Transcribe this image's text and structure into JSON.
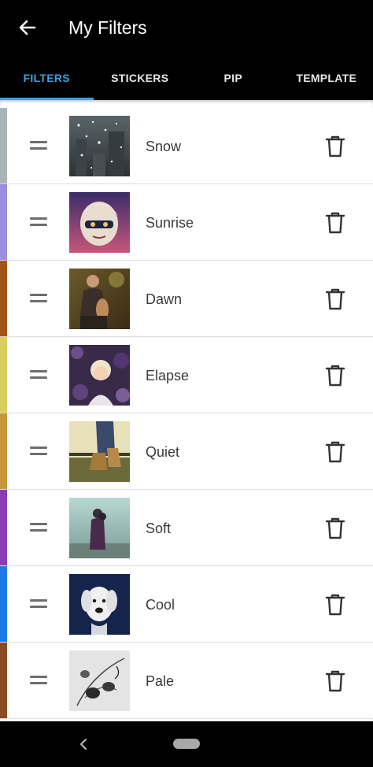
{
  "appbar": {
    "title": "My Filters",
    "back_icon": "arrow-left-icon"
  },
  "tabs": [
    {
      "label": "FILTERS",
      "active": true
    },
    {
      "label": "STICKERS",
      "active": false
    },
    {
      "label": "PIP",
      "active": false
    },
    {
      "label": "TEMPLATE",
      "active": false
    }
  ],
  "colors": {
    "accent": "#3d9fe0",
    "background": "#000000",
    "list_background": "#ffffff"
  },
  "filters": [
    {
      "name": "Snow",
      "stripe_color": "#a9b4b8",
      "thumb": "snowy-street-photo"
    },
    {
      "name": "Sunrise",
      "stripe_color": "#9a8ee0",
      "thumb": "masked-figure-illustration"
    },
    {
      "name": "Dawn",
      "stripe_color": "#a0541a",
      "thumb": "man-with-dog-photo"
    },
    {
      "name": "Elapse",
      "stripe_color": "#d8cf5c",
      "thumb": "child-portrait-photo"
    },
    {
      "name": "Quiet",
      "stripe_color": "#c9963a",
      "thumb": "boots-on-grass-photo"
    },
    {
      "name": "Soft",
      "stripe_color": "#8a3cb5",
      "thumb": "couple-embracing-photo"
    },
    {
      "name": "Cool",
      "stripe_color": "#1e79e6",
      "thumb": "white-dog-photo"
    },
    {
      "name": "Pale",
      "stripe_color": "#8b4a1f",
      "thumb": "botanical-sketch-photo"
    }
  ],
  "icons": {
    "drag": "drag-handle-icon",
    "delete": "trash-icon"
  },
  "navbar": {
    "back_icon": "nav-back-icon",
    "home_icon": "home-pill-icon"
  }
}
